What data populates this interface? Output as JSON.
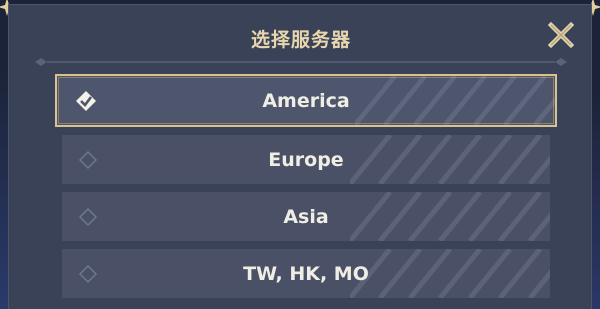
{
  "dialog": {
    "title": "选择服务器",
    "close_icon": "close-x-icon"
  },
  "servers": [
    {
      "label": "America",
      "selected": true,
      "icon": "checkmark-diamond-icon"
    },
    {
      "label": "Europe",
      "selected": false,
      "icon": "empty-diamond-icon"
    },
    {
      "label": "Asia",
      "selected": false,
      "icon": "empty-diamond-icon"
    },
    {
      "label": "TW, HK, MO",
      "selected": false,
      "icon": "empty-diamond-icon"
    }
  ],
  "colors": {
    "panel": "#3a4257",
    "item": "#4a5167",
    "accent_gold": "#d8c28f",
    "title_text": "#e8d6ae",
    "item_text": "#f0ede4"
  }
}
